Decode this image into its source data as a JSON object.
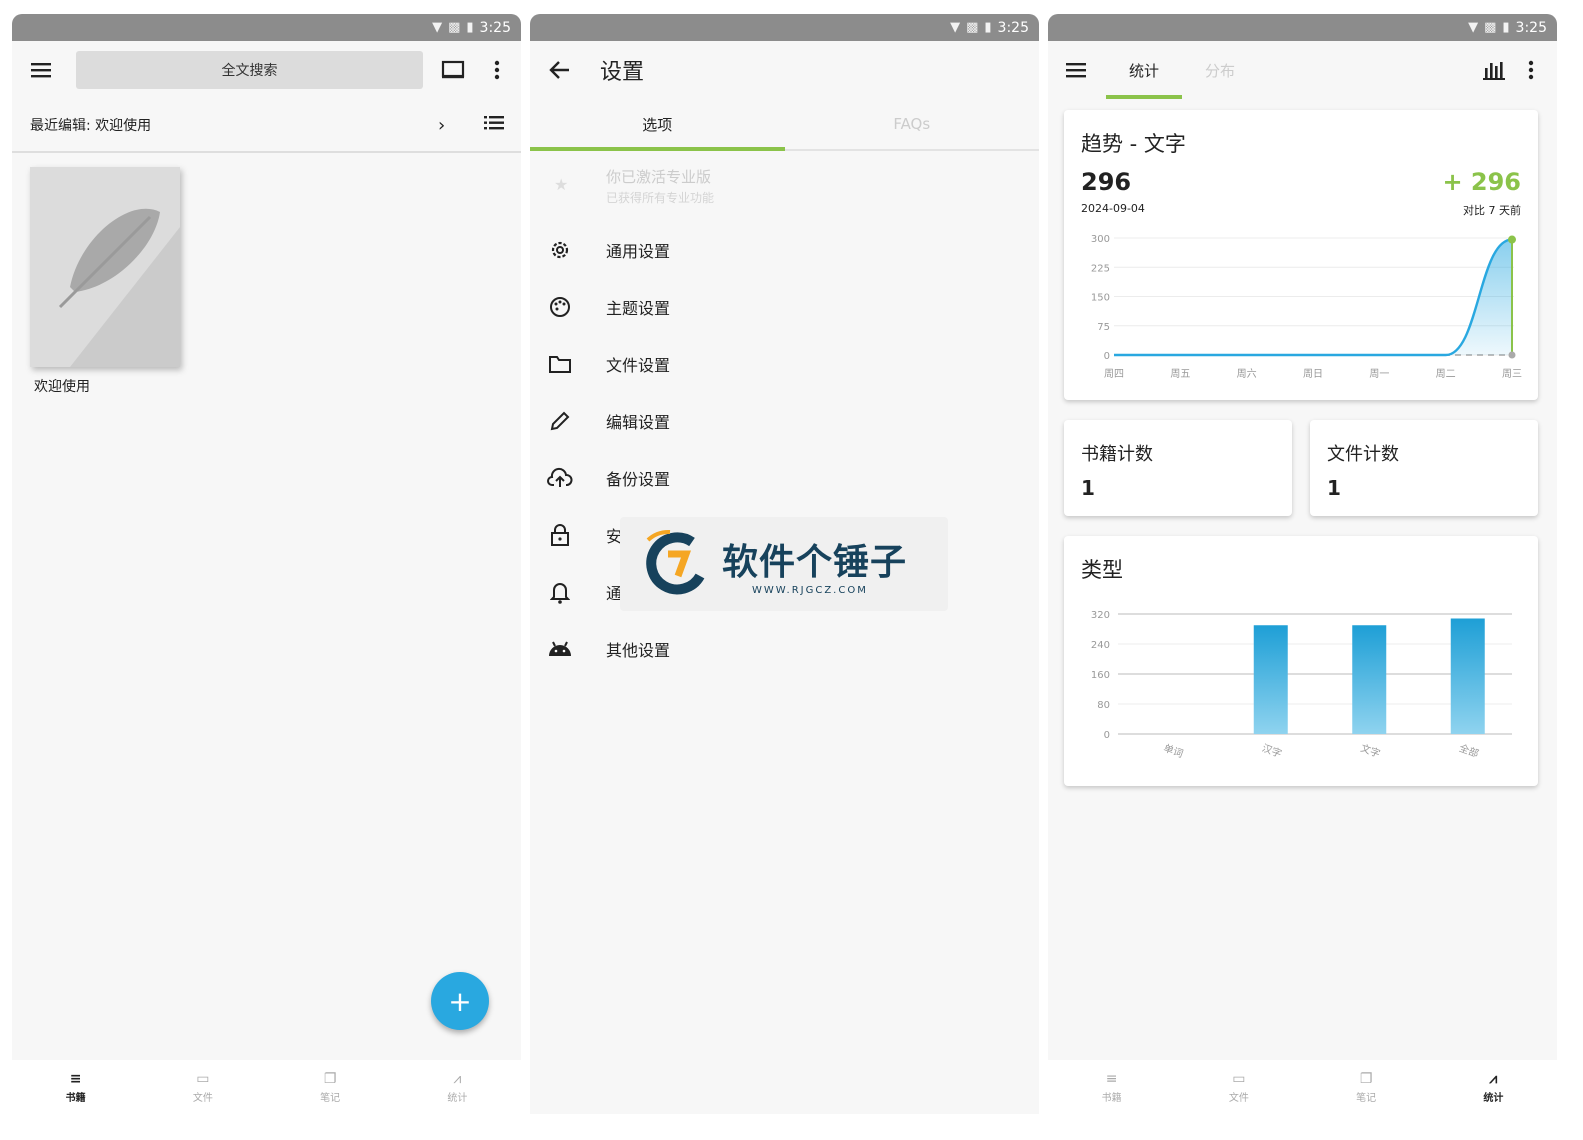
{
  "status": {
    "time": "3:25"
  },
  "colors": {
    "accent_green": "#8bc34a",
    "fab_blue": "#29a8e0",
    "chart_blue": "#29a8e0",
    "watermark_blue": "#17425c"
  },
  "books_screen": {
    "search_label": "全文搜索",
    "recent_label": "最近编辑: 欢迎使用",
    "book_title": "欢迎使用",
    "fab_label": "+"
  },
  "bottom_nav": [
    {
      "label": "书籍",
      "icon": "book-edit-icon"
    },
    {
      "label": "文件",
      "icon": "folder-icon"
    },
    {
      "label": "笔记",
      "icon": "notes-icon"
    },
    {
      "label": "统计",
      "icon": "stats-icon"
    }
  ],
  "settings_screen": {
    "title": "设置",
    "tabs": [
      "选项",
      "FAQs"
    ],
    "pro_title": "你已激活专业版",
    "pro_subtitle": "已获得所有专业功能",
    "items": [
      {
        "label": "通用设置",
        "icon": "gear-icon"
      },
      {
        "label": "主题设置",
        "icon": "palette-icon"
      },
      {
        "label": "文件设置",
        "icon": "folder-icon"
      },
      {
        "label": "编辑设置",
        "icon": "pencil-icon"
      },
      {
        "label": "备份设置",
        "icon": "cloud-upload-icon"
      },
      {
        "label": "安",
        "icon": "lock-icon"
      },
      {
        "label": "通",
        "icon": "bell-icon"
      },
      {
        "label": "其他设置",
        "icon": "android-icon"
      }
    ],
    "watermark": {
      "text": "软件个锤子",
      "url": "WWW.RJGCZ.COM"
    }
  },
  "stats_screen": {
    "tabs": [
      "统计",
      "分布"
    ],
    "trend_title": "趋势 - 文字",
    "trend_value": "296",
    "trend_date": "2024-09-04",
    "trend_delta": "+ 296",
    "trend_compare": "对比 7 天前",
    "book_count_title": "书籍计数",
    "book_count": "1",
    "file_count_title": "文件计数",
    "file_count": "1",
    "type_title": "类型"
  },
  "chart_data": [
    {
      "type": "line",
      "title": "趋势 - 文字",
      "categories": [
        "周四",
        "周五",
        "周六",
        "周日",
        "周一",
        "周二",
        "周三"
      ],
      "series": [
        {
          "values": [
            0,
            0,
            0,
            0,
            0,
            0,
            296
          ]
        },
        {
          "values": [
            0,
            0,
            0,
            0,
            0,
            0,
            0
          ],
          "dashed": true
        }
      ],
      "yticks": [
        0,
        75,
        150,
        225,
        300
      ],
      "ylim": [
        0,
        300
      ]
    },
    {
      "type": "bar",
      "title": "类型",
      "categories": [
        "单词",
        "汉字",
        "文字",
        "全部"
      ],
      "values": [
        0,
        290,
        290,
        308
      ],
      "yticks": [
        0,
        80,
        160,
        240,
        320
      ],
      "ylim": [
        0,
        320
      ]
    }
  ]
}
